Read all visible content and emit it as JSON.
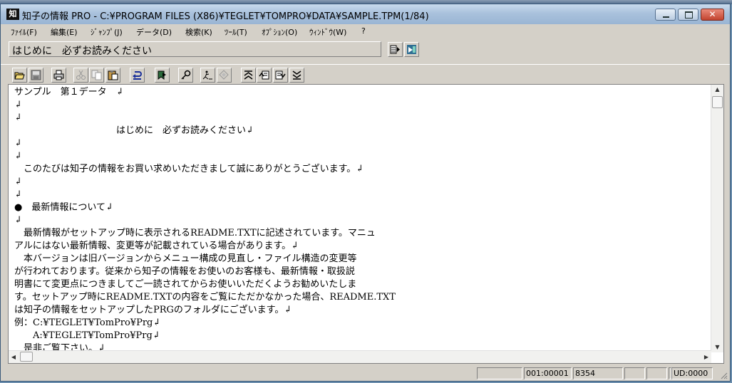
{
  "window": {
    "app_icon_text": "知",
    "title": "知子の情報 PRO - C:¥PROGRAM FILES (X86)¥TEGLET¥TOMPRO¥DATA¥SAMPLE.TPM(1/84)",
    "minimize_glyph": "",
    "maximize_glyph": "",
    "close_glyph": "✕"
  },
  "menu": [
    "ﾌｧｲﾙ(F)",
    "編集(E)",
    "ｼﾞｬﾝﾌﾟ(J)",
    "データ(D)",
    "検索(K)",
    "ﾂｰﾙ(T)",
    "ｵﾌﾟｼｮﾝ(O)",
    "ｳｨﾝﾄﾞｳ(W)",
    "?"
  ],
  "topic": {
    "title": "はじめに　必ずお読みください"
  },
  "icons": {
    "list_view": "list-view-icon",
    "tree_view": "tree-view-icon",
    "open": "open-folder-icon",
    "save": "save-icon",
    "print": "print-icon",
    "cut": "cut-icon",
    "copy": "copy-icon",
    "paste": "paste-icon",
    "undo": "undo-icon",
    "bookmark": "bookmark-icon",
    "search": "search-key-icon",
    "jump": "jump-icon",
    "replace": "replace-icon",
    "first": "first-page-icon",
    "prev": "prev-page-icon",
    "next": "next-page-icon",
    "last": "last-page-icon"
  },
  "document": {
    "lines": [
      "サンプル　第１データ　↲",
      "↲",
      "↲",
      "　　　　　　　　　　　はじめに　必ずお読みください↲",
      "↲",
      "↲",
      "　このたびは知子の情報をお買い求めいただきまして誠にありがとうございます。↲",
      "↲",
      "↲",
      "●　最新情報について↲",
      "↲",
      "　最新情報がセットアップ時に表示されるREADME.TXTに記述されています。マニュ",
      "アルにはない最新情報、変更等が記載されている場合があります。↲",
      "　本バージョンは旧バージョンからメニュー構成の見直し・ファイル構造の変更等",
      "が行われております。従来から知子の情報をお使いのお客様も、最新情報・取扱説",
      "明書にて変更点につきましてご一読されてからお使いいただくようお勧めいたしま",
      "す。セットアップ時にREADME.TXTの内容をご覧にただかなかった場合、README.TXT",
      "は知子の情報をセットアップしたPRGのフォルダにございます。↲",
      "例：C:¥TEGLET¥TomPro¥Prg↲",
      "　　A:¥TEGLET¥TomPro¥Prg↲",
      "　是非ご覧下さい。↲"
    ]
  },
  "status": {
    "panel1": "",
    "position": "001:00001",
    "size": "8354",
    "panel4": "",
    "panel5": "",
    "panel6": "",
    "ud": "UD:0000"
  }
}
